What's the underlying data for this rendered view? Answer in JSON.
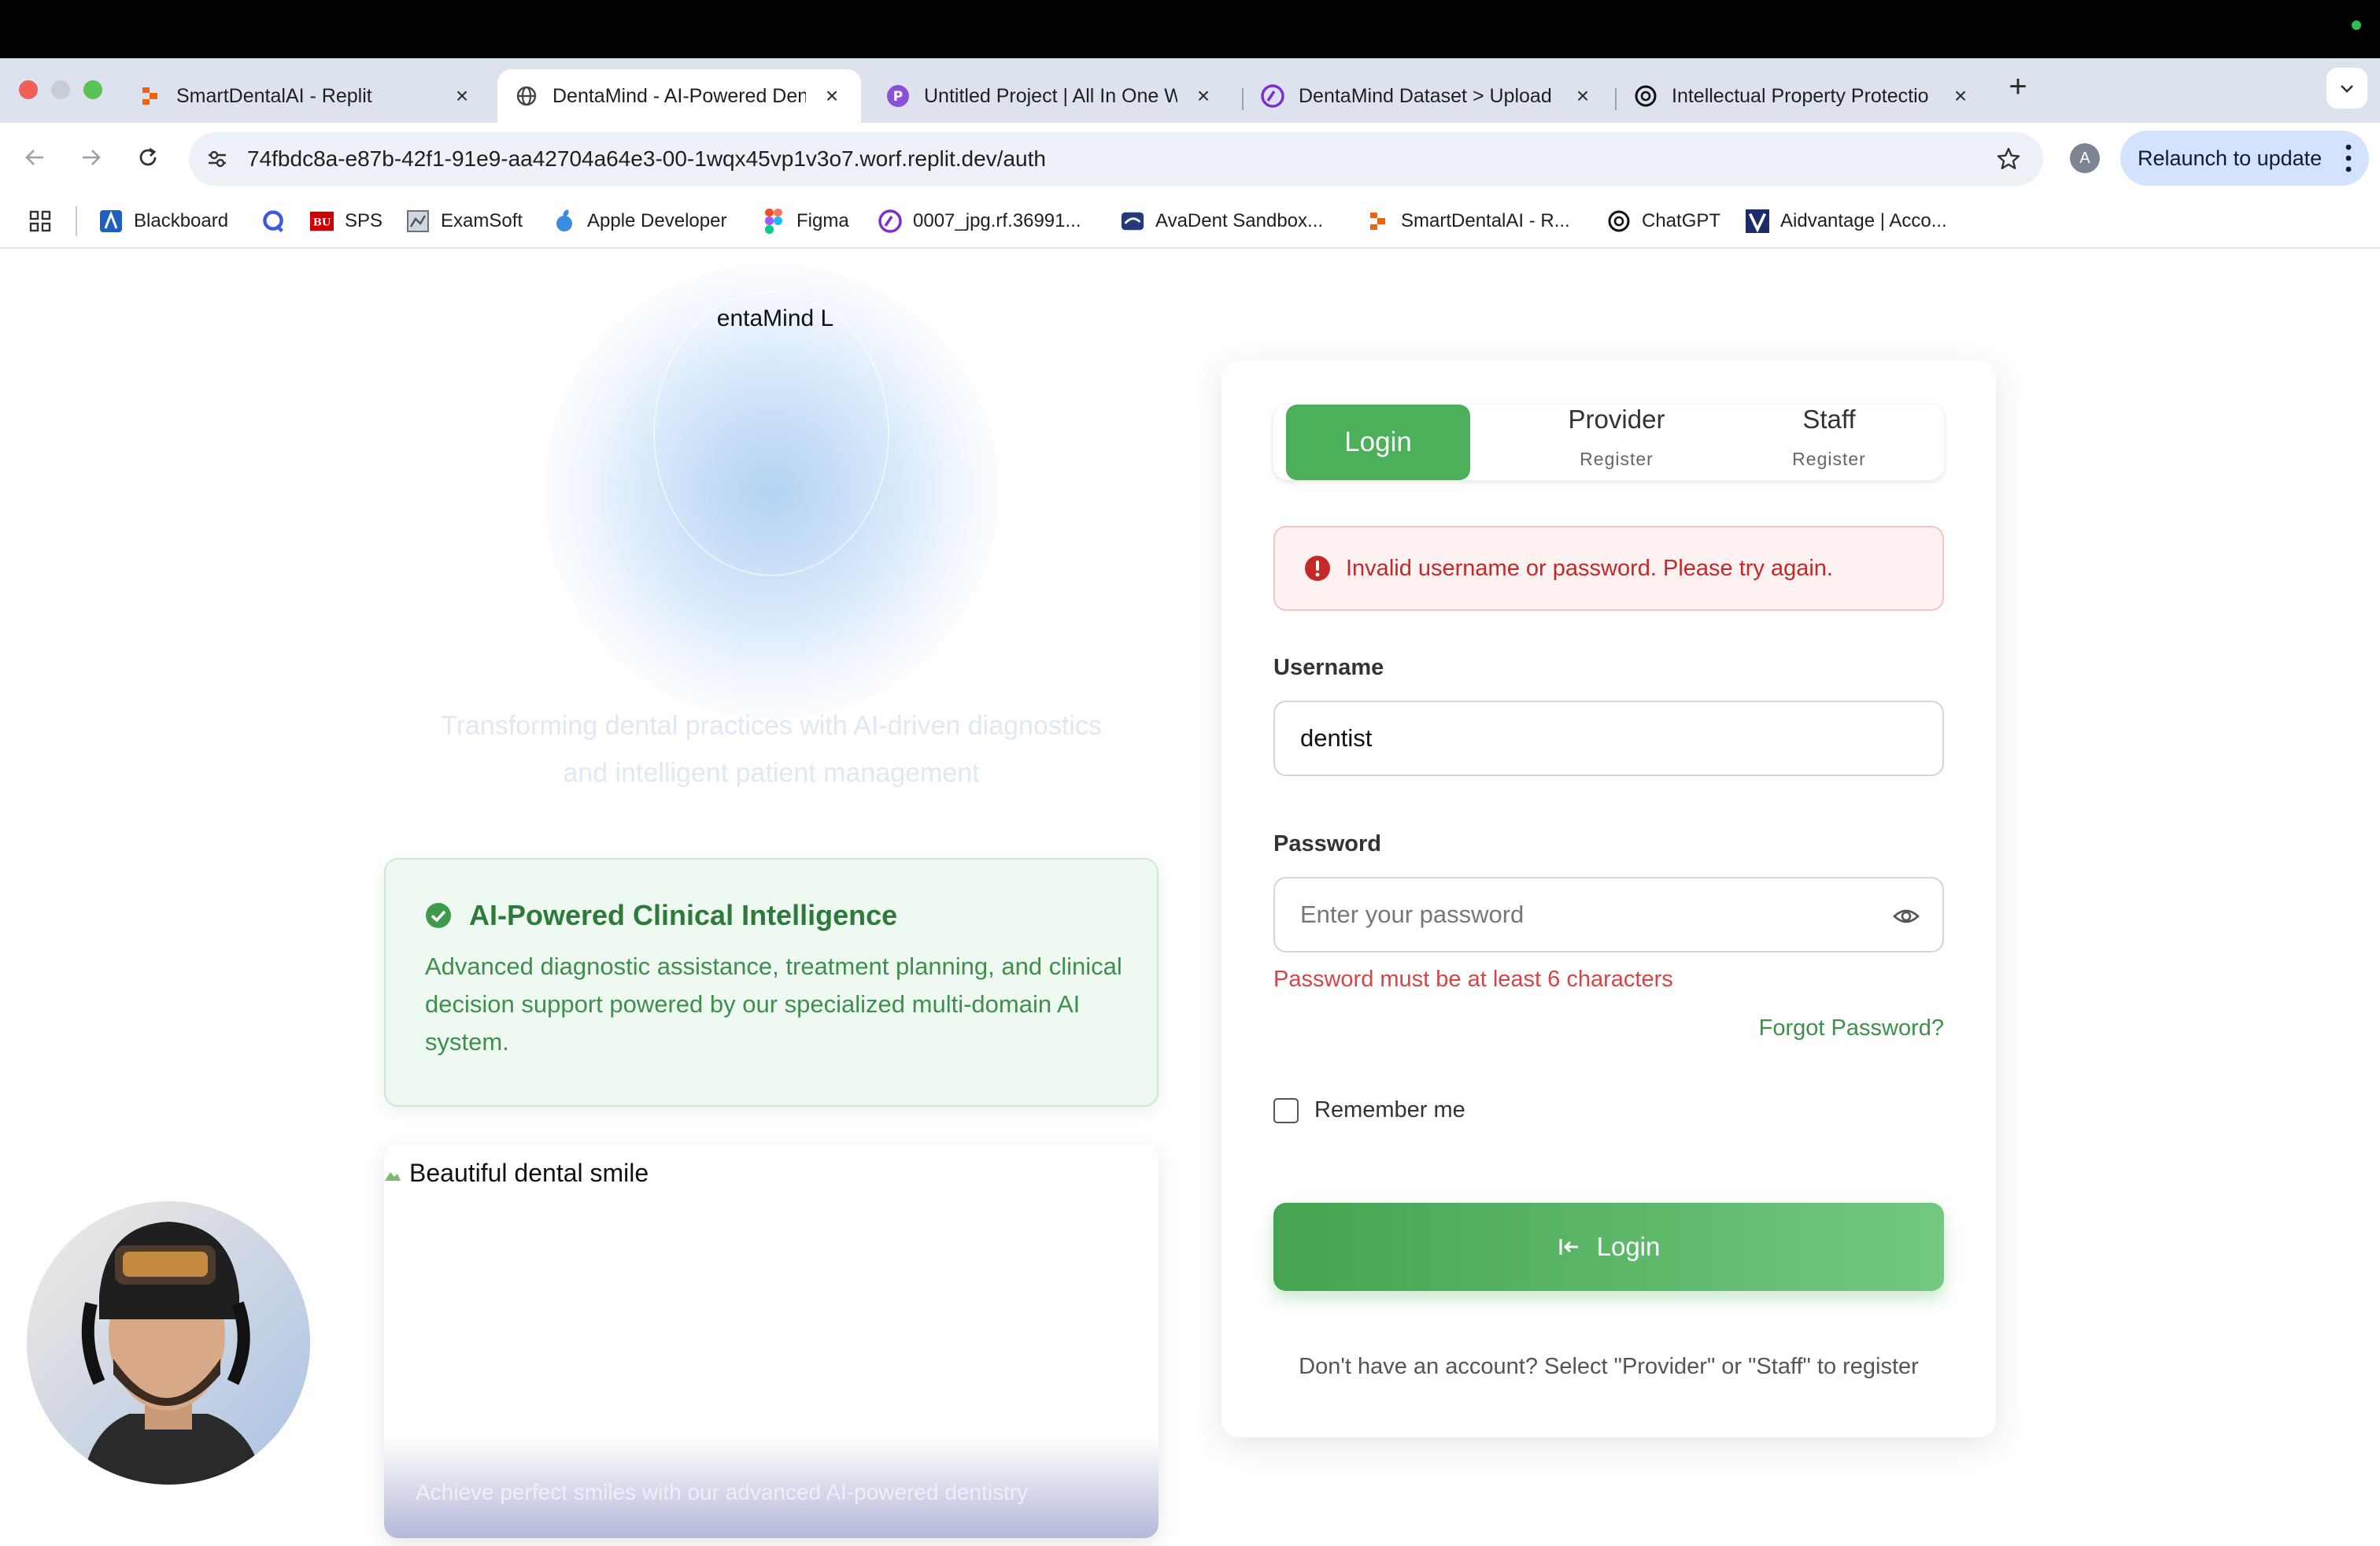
{
  "browser": {
    "tabs": [
      {
        "title": "SmartDentalAI - Replit",
        "icon": "replit-icon",
        "active": false
      },
      {
        "title": "DentaMind - AI-Powered Den",
        "icon": "globe-icon",
        "active": true
      },
      {
        "title": "Untitled Project | All In One W",
        "icon": "project-icon",
        "active": false
      },
      {
        "title": "DentaMind Dataset > Upload",
        "icon": "roboflow-icon",
        "active": false
      },
      {
        "title": "Intellectual Property Protectio",
        "icon": "openai-icon",
        "active": false
      }
    ],
    "tab_close_glyph": "×",
    "new_tab_glyph": "+",
    "url": "74fbdc8a-e87b-42f1-91e9-aa42704a64e3-00-1wqx45vp1v3o7.worf.replit.dev/auth",
    "profile_initial": "A",
    "relaunch_label": "Relaunch to update",
    "bookmarks": [
      {
        "label": "Blackboard",
        "icon": "blackboard-icon"
      },
      {
        "label": "",
        "icon": "search-app-icon"
      },
      {
        "label": "SPS",
        "icon": "bu-icon"
      },
      {
        "label": "ExamSoft",
        "icon": "examsoft-icon"
      },
      {
        "label": "Apple Developer",
        "icon": "apple-icon"
      },
      {
        "label": "Figma",
        "icon": "figma-icon"
      },
      {
        "label": "0007_jpg.rf.36991...",
        "icon": "roboflow-icon"
      },
      {
        "label": "AvaDent Sandbox...",
        "icon": "avadent-icon"
      },
      {
        "label": "SmartDentalAI - R...",
        "icon": "replit-icon"
      },
      {
        "label": "ChatGPT",
        "icon": "openai-icon"
      },
      {
        "label": "Aidvantage | Acco...",
        "icon": "aidvantage-icon"
      }
    ]
  },
  "hero": {
    "logo_text": "entaMind L",
    "tagline": "Transforming dental practices with AI-driven diagnostics and intelligent patient management"
  },
  "feature": {
    "title": "AI-Powered Clinical Intelligence",
    "description": "Advanced diagnostic assistance, treatment planning, and clinical decision support powered by our specialized multi-domain AI system."
  },
  "image_card": {
    "alt": "Beautiful dental smile",
    "caption": "Achieve perfect smiles with our advanced AI-powered dentistry"
  },
  "auth": {
    "tabs": {
      "login": "Login",
      "provider": "Provider",
      "provider_sub": "Register",
      "staff": "Staff",
      "staff_sub": "Register"
    },
    "alert": "Invalid username or password. Please try again.",
    "username_label": "Username",
    "username_value": "dentist",
    "password_label": "Password",
    "password_placeholder": "Enter your password",
    "password_error": "Password must be at least 6 characters",
    "forgot": "Forgot Password?",
    "remember": "Remember me",
    "remember_checked": false,
    "submit": "Login",
    "footer": "Don't have an account? Select \"Provider\" or \"Staff\" to register"
  },
  "colors": {
    "primary_green": "#4caf5a",
    "error_red": "#c62828",
    "alert_bg": "#fdf1f1",
    "feature_bg": "#eefaf1"
  }
}
